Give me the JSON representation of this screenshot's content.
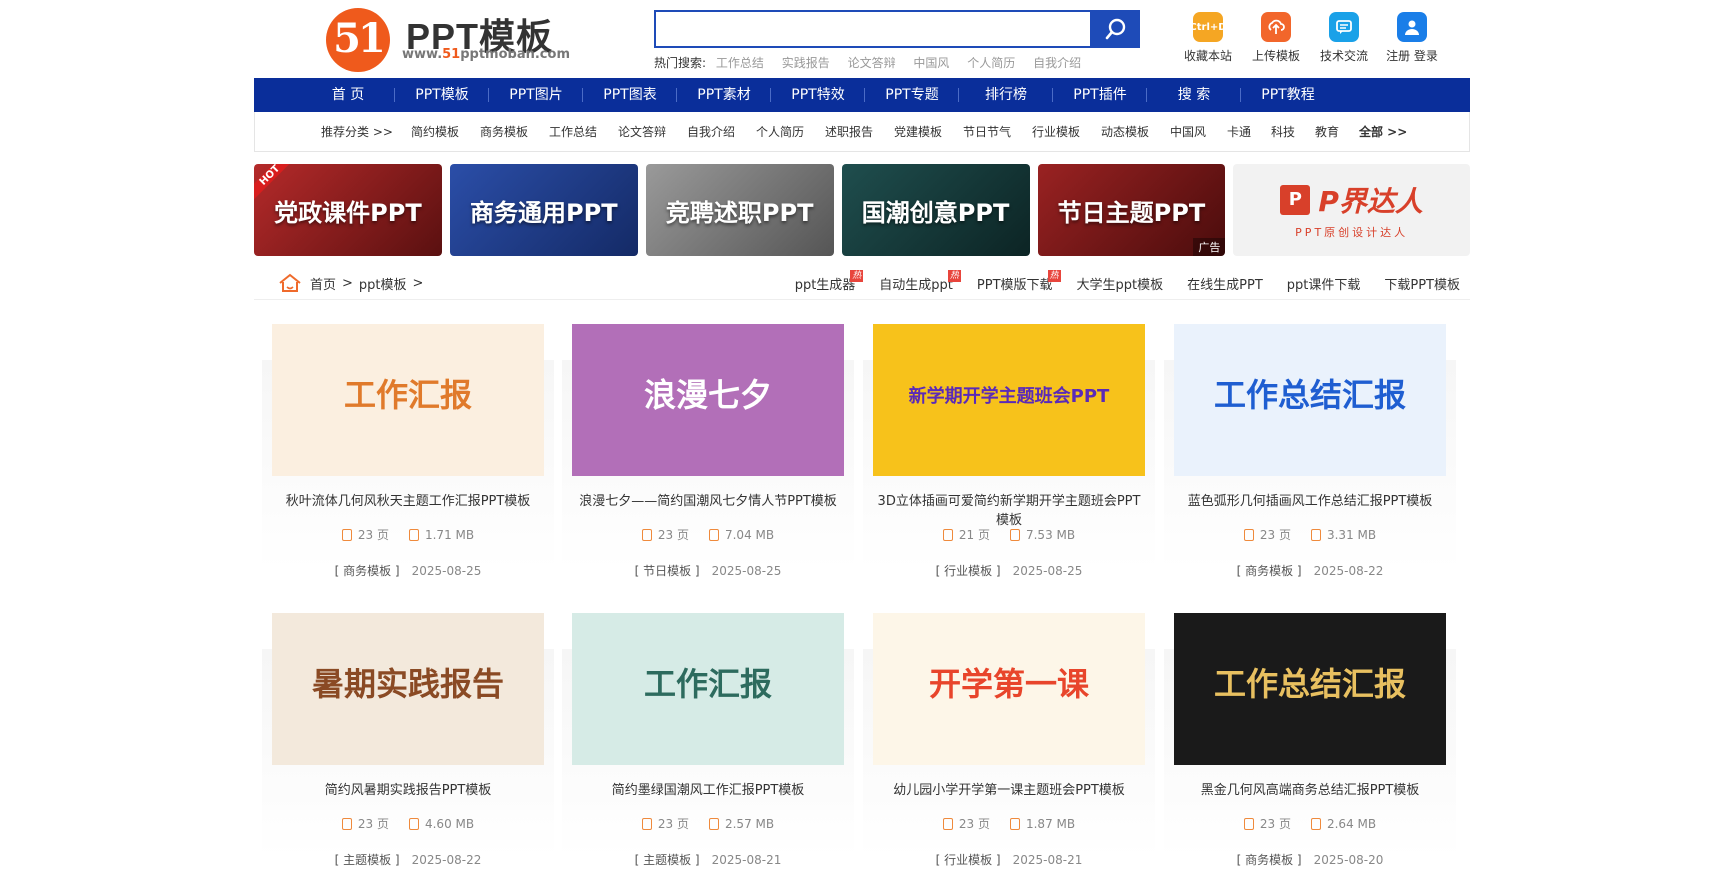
{
  "header": {
    "logo_mark": "51",
    "logo_text": "PPT模板",
    "url_prefix": "www.",
    "url_num": "51",
    "url_suffix": "pptmoban.com",
    "search_placeholder": "",
    "hot_label": "热门搜索:",
    "hot_terms": [
      "工作总结",
      "实践报告",
      "论文答辩",
      "中国风",
      "个人简历",
      "自我介绍"
    ],
    "tools": [
      {
        "label": "收藏本站",
        "icon": "bookmark-icon",
        "badge": "Ctrl+D",
        "color": "#f5a623"
      },
      {
        "label": "上传模板",
        "icon": "upload-icon",
        "color": "#f2662b"
      },
      {
        "label": "技术交流",
        "icon": "chat-icon",
        "color": "#1aa1e8"
      },
      {
        "label": "注册 登录",
        "icon": "user-icon",
        "color": "#1a7ee8"
      }
    ]
  },
  "nav": [
    "首 页",
    "PPT模板",
    "PPT图片",
    "PPT图表",
    "PPT素材",
    "PPT特效",
    "PPT专题",
    "排行榜",
    "PPT插件",
    "搜 索",
    "PPT教程"
  ],
  "subnav": [
    "推荐分类 >>",
    "简约模板",
    "商务模板",
    "工作总结",
    "论文答辩",
    "自我介绍",
    "个人简历",
    "述职报告",
    "党建模板",
    "节日节气",
    "行业模板",
    "动态模板",
    "中国风",
    "卡通",
    "科技",
    "教育",
    "全部 >>"
  ],
  "banners": [
    {
      "title": "党政课件PPT",
      "hot": "HOT",
      "bg": "#8a1f1f"
    },
    {
      "title": "商务通用PPT",
      "bg": "#1f3e8a"
    },
    {
      "title": "竞聘述职PPT",
      "bg": "#7a7a7a"
    },
    {
      "title": "国潮创意PPT",
      "bg": "#143a3a"
    },
    {
      "title": "节日主题PPT",
      "bg": "#7a1818",
      "ad": "广告"
    },
    {
      "title": "P界达人",
      "subtitle": "PPT原创设计达人"
    }
  ],
  "breadcrumb": {
    "home": "首页",
    "sep": ">",
    "current": "ppt模板",
    "sep2": ">"
  },
  "hotlinks": [
    {
      "text": "ppt生成器",
      "badge": "热"
    },
    {
      "text": "自动生成ppt",
      "badge": "热"
    },
    {
      "text": "PPT模版下载",
      "badge": "热"
    },
    {
      "text": "大学生ppt模板"
    },
    {
      "text": "在线生成PPT"
    },
    {
      "text": "ppt课件下载"
    },
    {
      "text": "下载PPT模板"
    }
  ],
  "cards": [
    {
      "title": "秋叶流体几何风秋天主题工作汇报PPT模板",
      "pages": "23 页",
      "size": "1.71 MB",
      "category": "[ 商务模板 ]",
      "date": "2025-08-25",
      "thumb_text": "工作汇报",
      "thumb_bg": "#fbefe0",
      "thumb_color": "#e07a2b"
    },
    {
      "title": "浪漫七夕——简约国潮风七夕情人节PPT模板",
      "pages": "23 页",
      "size": "7.04 MB",
      "category": "[ 节日模板 ]",
      "date": "2025-08-25",
      "thumb_text": "浪漫七夕",
      "thumb_bg": "#b26fb8",
      "thumb_color": "#ffffff"
    },
    {
      "title": "3D立体插画可爱简约新学期开学主题班会PPT模板",
      "pages": "21 页",
      "size": "7.53 MB",
      "category": "[ 行业模板 ]",
      "date": "2025-08-25",
      "thumb_text": "新学期开学主题班会PPT",
      "thumb_bg": "#f7c21b",
      "thumb_color": "#5a2ab8"
    },
    {
      "title": "蓝色弧形几何插画风工作总结汇报PPT模板",
      "pages": "23 页",
      "size": "3.31 MB",
      "category": "[ 商务模板 ]",
      "date": "2025-08-22",
      "thumb_text": "工作总结汇报",
      "thumb_bg": "#eaf2fc",
      "thumb_color": "#1f5ed1"
    },
    {
      "title": "简约风暑期实践报告PPT模板",
      "pages": "23 页",
      "size": "4.60 MB",
      "category": "[ 主题模板 ]",
      "date": "2025-08-22",
      "thumb_text": "暑期实践报告",
      "thumb_bg": "#f3e9dc",
      "thumb_color": "#8a4a24"
    },
    {
      "title": "简约墨绿国潮风工作汇报PPT模板",
      "pages": "23 页",
      "size": "2.57 MB",
      "category": "[ 主题模板 ]",
      "date": "2025-08-21",
      "thumb_text": "工作汇报",
      "thumb_bg": "#d6ebe6",
      "thumb_color": "#2d6b5e"
    },
    {
      "title": "幼儿园小学开学第一课主题班会PPT模板",
      "pages": "23 页",
      "size": "1.87 MB",
      "category": "[ 行业模板 ]",
      "date": "2025-08-21",
      "thumb_text": "开学第一课",
      "thumb_bg": "#fdf6e8",
      "thumb_color": "#e8452b"
    },
    {
      "title": "黑金几何风高端商务总结汇报PPT模板",
      "pages": "23 页",
      "size": "2.64 MB",
      "category": "[ 商务模板 ]",
      "date": "2025-08-20",
      "thumb_text": "工作总结汇报",
      "thumb_bg": "#1a1a1a",
      "thumb_color": "#e8c060"
    }
  ]
}
